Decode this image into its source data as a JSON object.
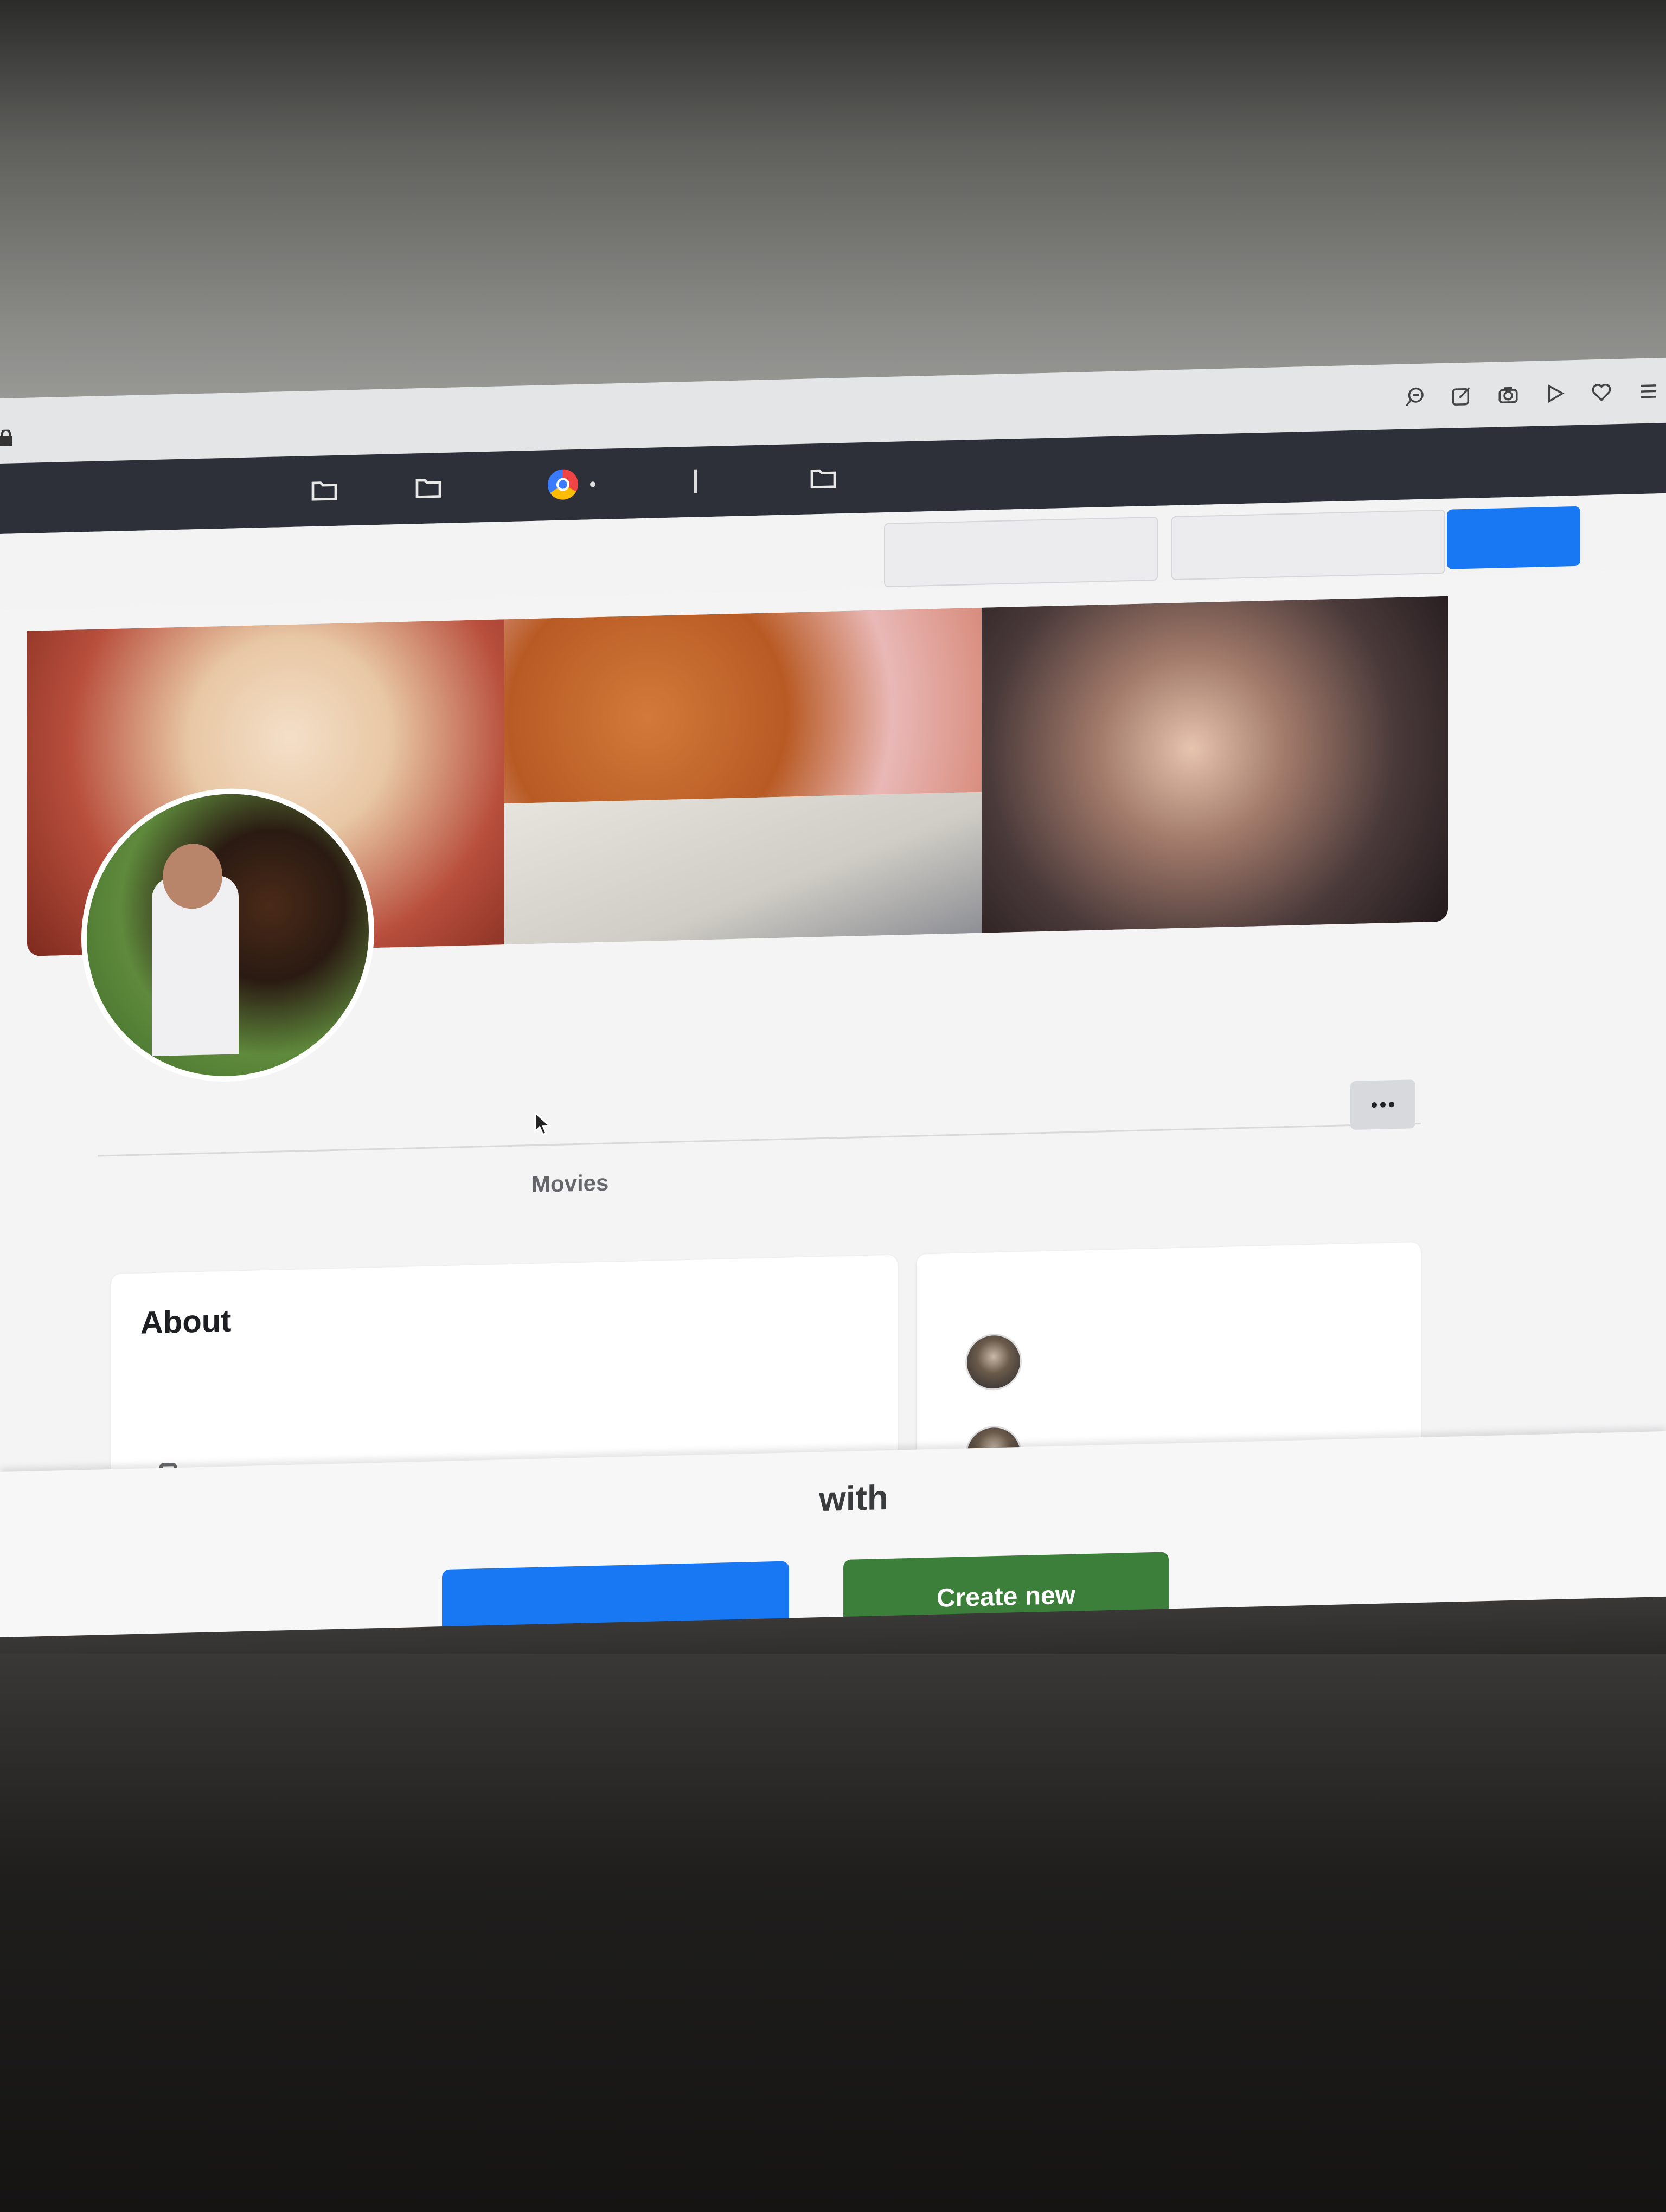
{
  "bookmarks": [
    "folder-icon",
    "folder-icon",
    "chrome-icon",
    "separator",
    "folder-icon"
  ],
  "toolbar": {
    "icons": [
      "search-icon",
      "edit-icon",
      "camera-icon",
      "play-icon",
      "heart-icon",
      "menu-icon"
    ]
  },
  "profile": {
    "tab_label": "Movies"
  },
  "about": {
    "title": "About"
  },
  "banner": {
    "with_text": "with",
    "create_label": "Create new"
  },
  "colors": {
    "primary_blue": "#1877f2",
    "create_green": "#3b7f3a",
    "bookmarks_bg": "#2d3038"
  }
}
